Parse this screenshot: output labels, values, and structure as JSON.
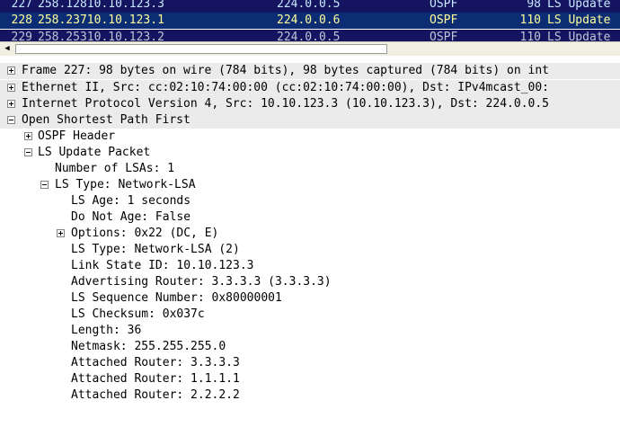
{
  "packet_list": {
    "rows": [
      {
        "no": "227",
        "time": "258.128",
        "source": "10.10.123.3",
        "destination": "224.0.0.5",
        "protocol": "OSPF",
        "length": "98",
        "info": "LS Update"
      },
      {
        "no": "228",
        "time": "258.237",
        "source": "10.10.123.1",
        "destination": "224.0.0.6",
        "protocol": "OSPF",
        "length": "110",
        "info": "LS Update"
      },
      {
        "no": "229",
        "time": "258.253",
        "source": "10.10.123.2",
        "destination": "224.0.0.5",
        "protocol": "OSPF",
        "length": "110",
        "info": "LS Update"
      }
    ]
  },
  "scrollbar": {
    "left_arrow": "◀"
  },
  "details": {
    "frame": "Frame 227: 98 bytes on wire (784 bits), 98 bytes captured (784 bits) on int",
    "ethernet": "Ethernet II, Src: cc:02:10:74:00:00 (cc:02:10:74:00:00), Dst: IPv4mcast_00:",
    "ip": "Internet Protocol Version 4, Src: 10.10.123.3 (10.10.123.3), Dst: 224.0.0.5",
    "ospf": "Open Shortest Path First",
    "ospf_header": "OSPF Header",
    "ls_update_packet": "LS Update Packet",
    "num_lsas": "Number of LSAs: 1",
    "ls_type_network": "LS Type: Network-LSA",
    "ls_age": "LS Age: 1 seconds",
    "do_not_age": "Do Not Age: False",
    "options": "Options: 0x22 (DC, E)",
    "ls_type_detail": "LS Type: Network-LSA (2)",
    "link_state_id": "Link State ID: 10.10.123.3",
    "advertising_router": "Advertising Router: 3.3.3.3 (3.3.3.3)",
    "ls_sequence": "LS Sequence Number: 0x80000001",
    "ls_checksum": "LS Checksum: 0x037c",
    "length": "Length: 36",
    "netmask": "Netmask: 255.255.255.0",
    "attached_1": "Attached Router: 3.3.3.3",
    "attached_2": "Attached Router: 1.1.1.1",
    "attached_3": "Attached Router: 2.2.2.2"
  },
  "colors": {
    "packet_bg": "#141460",
    "selected_bg": "#0c2c74",
    "selected_fg": "#ffff9a",
    "packet_fg": "#c8e8ff"
  }
}
